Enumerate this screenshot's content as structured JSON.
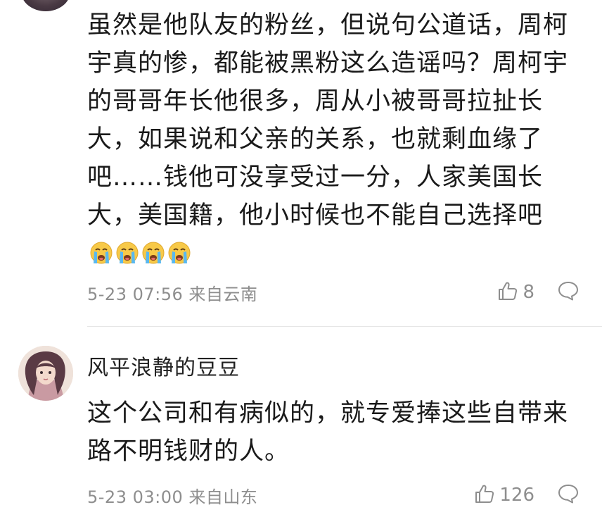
{
  "comments": [
    {
      "text": "虽然是他队友的粉丝，但说句公道话，周柯宇真的惨，都能被黑粉这么造谣吗？周柯宇的哥哥年长他很多，周从小被哥哥拉扯长大，如果说和父亲的关系，也就剩血缘了吧……钱他可没享受过一分，人家美国长大，美国籍，他小时候也不能自己选择吧",
      "emoji": [
        "cry-emoji",
        "cry-emoji",
        "cry-emoji",
        "cry-emoji"
      ],
      "meta": "5-23 07:56 来自云南",
      "likes": "8"
    },
    {
      "username": "风平浪静的豆豆",
      "text": "这个公司和有病似的，就专爱捧这些自带来路不明钱财的人。",
      "meta": "5-23 03:00 来自山东",
      "likes": "126"
    }
  ],
  "colors": {
    "text": "#1a1a1a",
    "meta": "#8e8e8e",
    "divider": "#e6e6e6"
  },
  "icons": {
    "like": "thumbs-up-icon",
    "reply": "comment-bubble-icon"
  }
}
